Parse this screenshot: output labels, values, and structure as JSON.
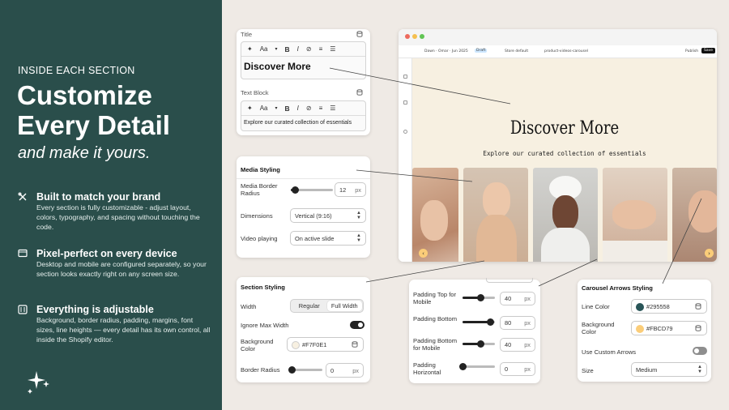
{
  "left": {
    "eyebrow": "INSIDE EACH SECTION",
    "headline_1": "Customize",
    "headline_2": "Every Detail",
    "tagline": "and make it yours.",
    "features": [
      {
        "icon": "tools-icon",
        "title": "Built to match your brand",
        "desc": "Every section is fully customizable - adjust layout, colors, typography, and spacing without touching the code."
      },
      {
        "icon": "device-icon",
        "title": "Pixel-perfect on every device",
        "desc": "Desktop and mobile are configured separately, so your section looks exactly right on any screen size."
      },
      {
        "icon": "sliders-icon",
        "title": "Everything is adjustable",
        "desc": "Background, border radius, padding, margins, font sizes, line heights — every detail has its own control, all inside the Shopify editor."
      }
    ],
    "bg_color": "#2a4e4b"
  },
  "text_card": {
    "title_label": "Title",
    "title_value": "Discover More",
    "textblock_label": "Text Block",
    "textblock_value": "Explore our curated collection of essentials",
    "toolbar": {
      "font": "Aa",
      "bold": "B",
      "italic": "I"
    }
  },
  "media_card": {
    "heading": "Media Styling",
    "border_radius_label": "Media Border Radius",
    "border_radius_value": "12",
    "border_radius_unit": "px",
    "border_radius_pct": 0.1,
    "dimensions_label": "Dimensions",
    "dimensions_value": "Vertical (9:16)",
    "video_label": "Video playing",
    "video_value": "On active slide"
  },
  "section_card": {
    "heading": "Section Styling",
    "width_label": "Width",
    "width_options": [
      "Regular",
      "Full Width"
    ],
    "width_selected": "Full Width",
    "ignore_label": "Ignore Max Width",
    "ignore_on": true,
    "bg_label": "Background Color",
    "bg_value": "#F7F0E1",
    "radius_label": "Border Radius",
    "radius_value": "0",
    "radius_unit": "px"
  },
  "padding_card": {
    "items": [
      {
        "label": "Padding Top for Mobile",
        "value": "40",
        "unit": "px",
        "pct": 0.55
      },
      {
        "label": "Padding Bottom",
        "value": "80",
        "unit": "px",
        "pct": 0.85
      },
      {
        "label": "Padding Bottom for Mobile",
        "value": "40",
        "unit": "px",
        "pct": 0.55
      },
      {
        "label": "Padding Horizontal",
        "value": "0",
        "unit": "px",
        "pct": 0.0
      }
    ]
  },
  "arrows_card": {
    "heading": "Carousel Arrows Styling",
    "line_label": "Line Color",
    "line_value": "#295558",
    "bg_label": "Background Color",
    "bg_value": "#FBCD79",
    "custom_label": "Use Custom Arrows",
    "custom_on": false,
    "size_label": "Size",
    "size_value": "Medium"
  },
  "browser": {
    "theme_label": "Dawn · Omar · Jun 2025",
    "draft_badge": "Draft",
    "store_label": "Store default",
    "template_label": "product-videos-carousel",
    "publish_label": "Publish",
    "save_label": "Save",
    "canvas_title": "Discover More",
    "canvas_subtitle": "Explore our curated collection of essentials",
    "canvas_bg": "#f7f0e1"
  }
}
